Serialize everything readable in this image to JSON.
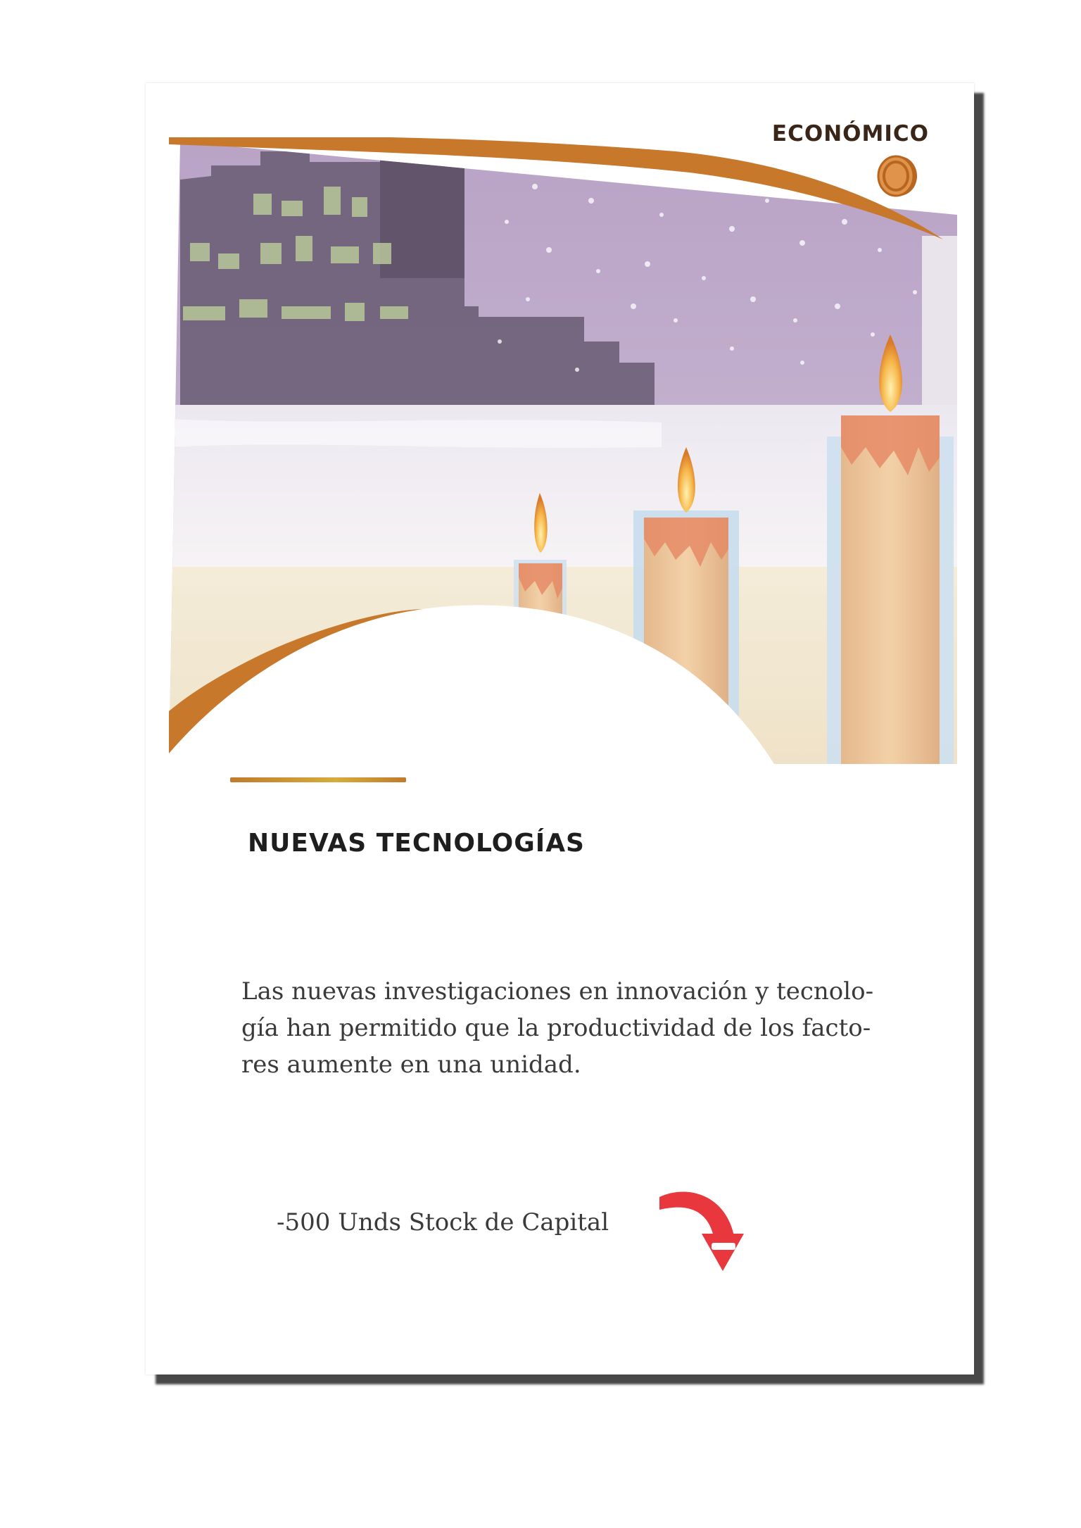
{
  "card": {
    "category": "ECONÓMICO",
    "category_icon": "coin-icon",
    "title": "NUEVAS TECNOLOGÍAS",
    "description": "Las nuevas investigaciones en innovación y tecnolo-\ngía han permitido que la productividad de los facto-\nres aumente en una unidad.",
    "effect": "-500 Unds Stock de Capital",
    "effect_icon": "down-arrow-icon"
  },
  "colors": {
    "accent": "#c7782a",
    "arrow": "#e8383d",
    "text": "#3a3a3a"
  }
}
